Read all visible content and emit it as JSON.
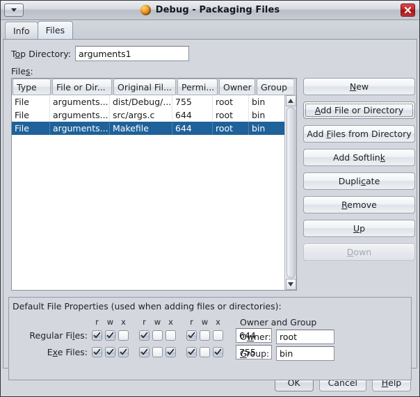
{
  "titlebar": {
    "title": "Debug - Packaging Files",
    "app_icon": "netbeans-ball-icon",
    "menu_icon": "chevron-down-icon",
    "close_icon": "close-icon"
  },
  "tabs": [
    {
      "label": "Info",
      "active": false
    },
    {
      "label": "Files",
      "active": true
    }
  ],
  "form": {
    "top_directory_label": "Top Directory:",
    "top_directory_label_pre": "T",
    "top_directory_label_mn": "o",
    "top_directory_label_post": "p Directory:",
    "top_directory_value": "arguments1",
    "files_label_pre": "File",
    "files_label_mn": "s",
    "files_label_post": ":"
  },
  "table": {
    "columns": [
      "Type",
      "File or Dir...",
      "Original Fil...",
      "Permi...",
      "Owner",
      "Group"
    ],
    "rows": [
      {
        "cells": [
          "File",
          "arguments...",
          "dist/Debug/...",
          "755",
          "root",
          "bin"
        ],
        "selected": false
      },
      {
        "cells": [
          "File",
          "arguments...",
          "src/args.c",
          "644",
          "root",
          "bin"
        ],
        "selected": false
      },
      {
        "cells": [
          "File",
          "arguments...",
          "Makefile",
          "644",
          "root",
          "bin"
        ],
        "selected": true
      }
    ],
    "selection_color": "#1f6199",
    "scrollbar": {
      "up_icon": "arrow-up-icon",
      "down_icon": "arrow-down-icon"
    }
  },
  "side_buttons": [
    {
      "label": "New",
      "pre": "",
      "mn": "N",
      "post": "ew",
      "state": "normal"
    },
    {
      "label": "Add File or Directory",
      "pre": "",
      "mn": "A",
      "post": "dd File or Directory",
      "state": "focused"
    },
    {
      "label": "Add Files from Directory",
      "pre": "Add ",
      "mn": "F",
      "post": "iles from Directory",
      "state": "normal"
    },
    {
      "label": "Add Softlink",
      "pre": "Add Softlin",
      "mn": "k",
      "post": "",
      "state": "normal"
    },
    {
      "label": "Duplicate",
      "pre": "Dupli",
      "mn": "c",
      "post": "ate",
      "state": "normal"
    },
    {
      "label": "Remove",
      "pre": "",
      "mn": "R",
      "post": "emove",
      "state": "normal"
    },
    {
      "label": "Up",
      "pre": "",
      "mn": "U",
      "post": "p",
      "state": "normal"
    },
    {
      "label": "Down",
      "pre": "",
      "mn": "D",
      "post": "own",
      "state": "disabled"
    }
  ],
  "properties": {
    "title": "Default File Properties (used when adding files or directories):",
    "permission_headers": [
      "r",
      "w",
      "x"
    ],
    "rows": [
      {
        "label_pre": "Regular Fi",
        "label_mn": "l",
        "label_post": "es:",
        "checks": [
          [
            true,
            true,
            false
          ],
          [
            true,
            false,
            false
          ],
          [
            true,
            false,
            false
          ]
        ],
        "value": "644"
      },
      {
        "label_pre": "E",
        "label_mn": "x",
        "label_post": "e Files:",
        "checks": [
          [
            true,
            true,
            true
          ],
          [
            true,
            false,
            true
          ],
          [
            true,
            false,
            true
          ]
        ],
        "value": "755"
      }
    ],
    "owner_group_title": "Owner and Group",
    "owner_label_pre": "O",
    "owner_label_mn": "w",
    "owner_label_post": "ner:",
    "owner_value": "root",
    "group_label_pre": "",
    "group_label_mn": "G",
    "group_label_post": "roup:",
    "group_value": "bin"
  },
  "footer": {
    "ok": "OK",
    "cancel": "Cancel",
    "help_pre": "",
    "help_mn": "H",
    "help_post": "elp"
  }
}
